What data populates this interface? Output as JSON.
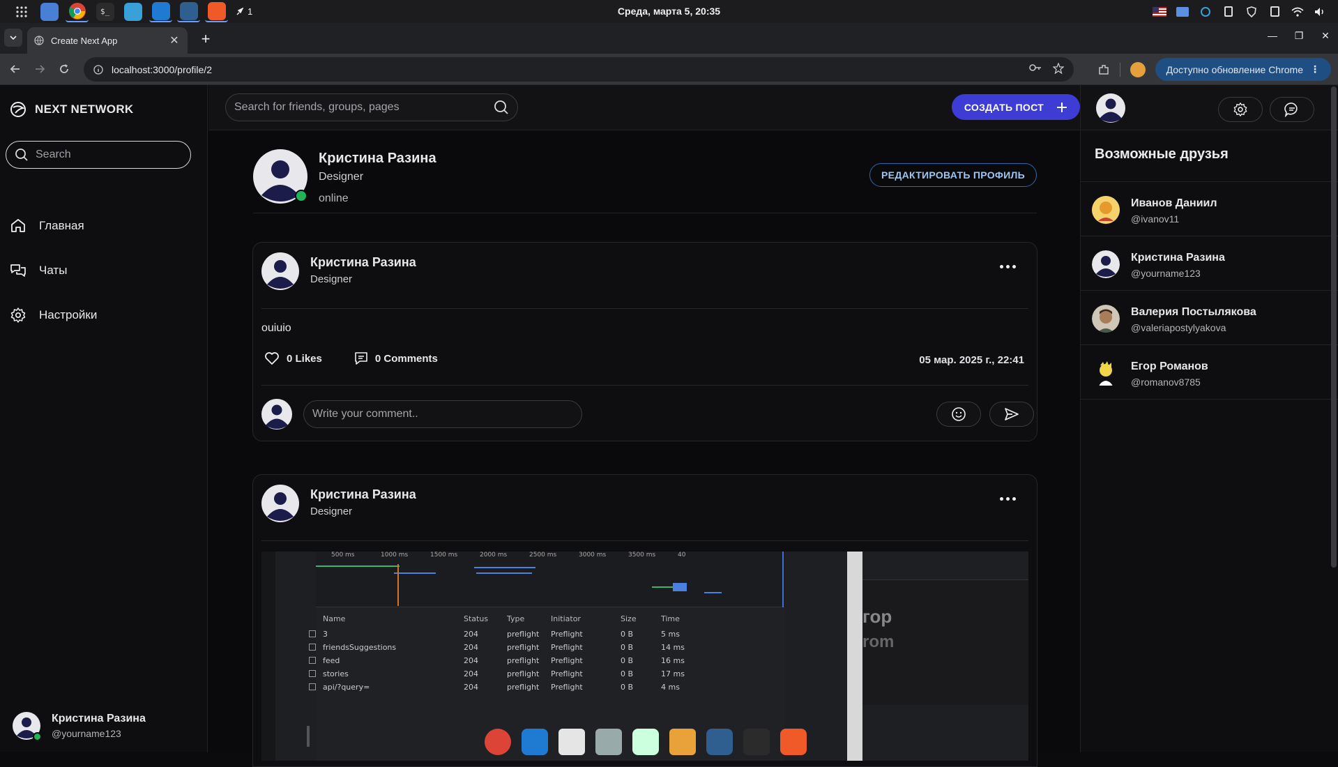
{
  "os": {
    "clock": "Среда, марта  5, 20:35",
    "notif_count": "1",
    "apps": [
      "grid-icon",
      "files-icon",
      "chrome-icon",
      "terminal-icon",
      "app-icon",
      "vscode-icon",
      "pgadmin-icon",
      "git-icon"
    ]
  },
  "browser": {
    "tab_title": "Create Next App",
    "url": "localhost:3000/profile/2",
    "update_label": "Доступно обновление Chrome"
  },
  "sidebar": {
    "brand": "NEXT NETWORK",
    "search_placeholder": "Search",
    "items": [
      {
        "label": "Главная",
        "icon": "home-icon"
      },
      {
        "label": "Чаты",
        "icon": "chats-icon"
      },
      {
        "label": "Настройки",
        "icon": "settings-icon"
      }
    ],
    "me": {
      "name": "Кристина Разина",
      "handle": "@yourname123"
    }
  },
  "header": {
    "search_placeholder": "Search for friends, groups, pages",
    "create_label": "СОЗДАТЬ ПОСТ"
  },
  "profile": {
    "name": "Кристина Разина",
    "role": "Designer",
    "status": "online",
    "edit_label": "РЕДАКТИРОВАТЬ ПРОФИЛЬ"
  },
  "posts": [
    {
      "author": "Кристина Разина",
      "role": "Designer",
      "text": "ouiuio",
      "likes": "0 Likes",
      "comments": "0 Comments",
      "date": "05 мар. 2025 г., 22:41",
      "comment_placeholder": "Write your comment.."
    },
    {
      "author": "Кристина Разина",
      "role": "Designer",
      "screenshot": {
        "ticks": [
          "500 ms",
          "1000 ms",
          "1500 ms",
          "2000 ms",
          "2500 ms",
          "3000 ms",
          "3500 ms",
          "40"
        ],
        "headers": [
          "Name",
          "Status",
          "Type",
          "Initiator",
          "Size",
          "Time"
        ],
        "rows": [
          [
            "3",
            "204",
            "preflight",
            "Preflight",
            "0 B",
            "5 ms"
          ],
          [
            "friendsSuggestions",
            "204",
            "preflight",
            "Preflight",
            "0 B",
            "14 ms"
          ],
          [
            "feed",
            "204",
            "preflight",
            "Preflight",
            "0 B",
            "16 ms"
          ],
          [
            "stories",
            "204",
            "preflight",
            "Preflight",
            "0 B",
            "17 ms"
          ],
          [
            "api/?query=",
            "204",
            "preflight",
            "Preflight",
            "0 B",
            "4 ms"
          ]
        ],
        "side_text": [
          "гор",
          "rom"
        ]
      }
    }
  ],
  "right": {
    "title": "Возможные друзья",
    "friends": [
      {
        "name": "Иванов Даниил",
        "handle": "@ivanov11",
        "avatar_color": "#e0a53a"
      },
      {
        "name": "Кристина Разина",
        "handle": "@yourname123",
        "avatar_color": "#2a2a6a"
      },
      {
        "name": "Валерия Постылякова",
        "handle": "@valeriapostylyakova",
        "avatar_color": "#8a7a6a"
      },
      {
        "name": "Егор Романов",
        "handle": "@romanov8785",
        "avatar_color": "#f2d64a"
      }
    ]
  }
}
